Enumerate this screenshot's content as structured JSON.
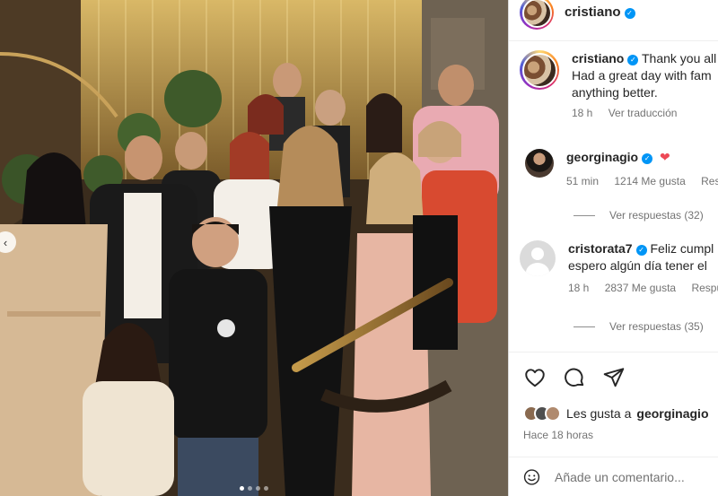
{
  "post": {
    "username": "cristiano",
    "verified": true
  },
  "caption": {
    "username": "cristiano",
    "text_line1": "Thank you all",
    "text_line2": "Had a great day with fam",
    "text_line3": "anything better.",
    "time": "18 h",
    "translate": "Ver traducción"
  },
  "comments": [
    {
      "username": "georginagio",
      "text": "❤",
      "time": "51 min",
      "likes": "1214 Me gusta",
      "reply": "Resp",
      "view_replies": "Ver respuestas (32)"
    },
    {
      "username": "cristorata7",
      "text_line1": "Feliz cumpl",
      "text_line2": "espero algún día tener el",
      "time": "18 h",
      "likes": "2837 Me gusta",
      "reply": "Respu",
      "view_replies": "Ver respuestas (35)"
    }
  ],
  "actions": {
    "like_icon": "heart-icon",
    "comment_icon": "comment-icon",
    "share_icon": "send-icon"
  },
  "likes_line": {
    "prefix": "Les gusta a",
    "user": "georginagio"
  },
  "time_ago": "Hace 18 horas",
  "add_comment": {
    "placeholder": "Añade un comentario...",
    "emoji_icon": "smiley-icon"
  },
  "carousel": {
    "prev_icon": "chevron-left-icon",
    "total_slides": 4,
    "active_slide": 1
  },
  "colors": {
    "verified": "#0095f6",
    "heart": "#ed4956",
    "secondary_text": "#737373"
  }
}
